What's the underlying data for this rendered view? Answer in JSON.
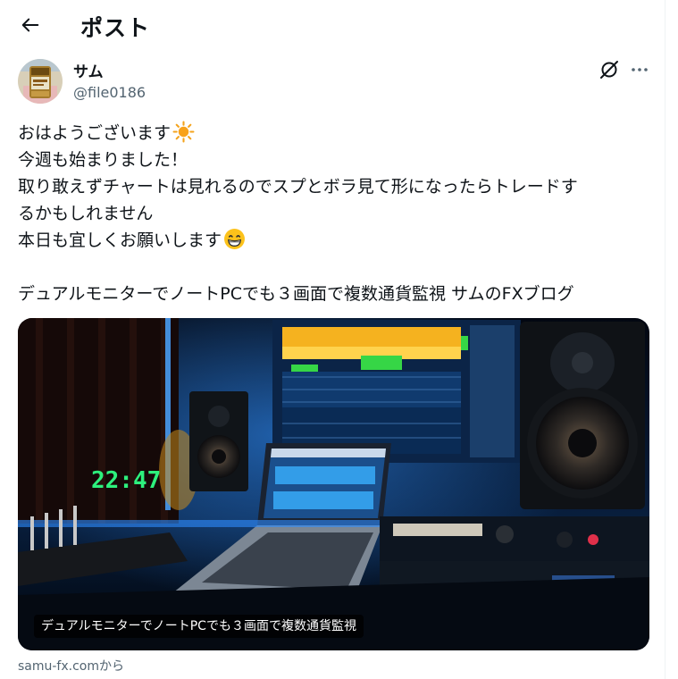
{
  "header": {
    "title": "ポスト"
  },
  "author": {
    "name": "サム",
    "handle": "@file0186"
  },
  "post": {
    "lines": [
      "おはようございます",
      "今週も始まりました！",
      "取り敢えずチャートは見れるのでスプとボラ見て形になったらトレードす",
      "るかもしれません",
      "本日も宜しくお願いします",
      "",
      "デュアルモニターでノートPCでも３画面で複数通貨監視  サムのFXブログ"
    ]
  },
  "card": {
    "clock_text": "22:47",
    "caption": "デュアルモニターでノートPCでも３画面で複数通貨監視",
    "source": "samu-fx.comから"
  }
}
